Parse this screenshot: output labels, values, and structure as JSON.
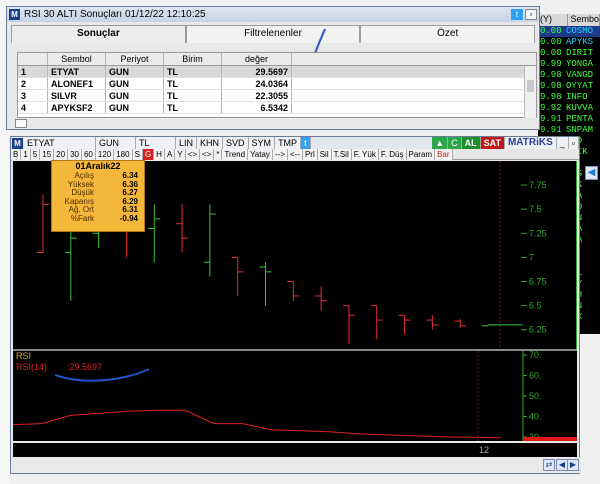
{
  "rsi_window": {
    "title": "RSI 30 ALTI Sonuçları 01/12/22 12:10:25",
    "tabs": [
      {
        "label": "Sonuçlar",
        "active": true
      },
      {
        "label": "Filtrelenenler",
        "active": false
      },
      {
        "label": "Özet",
        "active": false
      }
    ],
    "columns": [
      "",
      "Sembol",
      "Periyot",
      "Birim",
      "değer"
    ],
    "rows": [
      {
        "idx": "1",
        "symbol": "ETYAT",
        "period": "GUN",
        "unit": "TL",
        "value": "29.5697"
      },
      {
        "idx": "2",
        "symbol": "ALONEF1",
        "period": "GUN",
        "unit": "TL",
        "value": "24.0364"
      },
      {
        "idx": "3",
        "symbol": "SILVR",
        "period": "GUN",
        "unit": "TL",
        "value": "22.3055"
      },
      {
        "idx": "4",
        "symbol": "APYKSF2",
        "period": "GUN",
        "unit": "TL",
        "value": "6.5342"
      }
    ]
  },
  "bg_list": {
    "header": [
      "(Y)",
      "Sembo"
    ],
    "rows": [
      {
        "v": "0.00",
        "s": "COSMO",
        "c": true
      },
      {
        "v": "0.00",
        "s": "APYKS",
        "c": true
      },
      {
        "v": "0.00",
        "s": "DIRIT"
      },
      {
        "v": "9.99",
        "s": "YONGA"
      },
      {
        "v": "9.98",
        "s": "VANGD"
      },
      {
        "v": "9.98",
        "s": "OYYAT"
      },
      {
        "v": "9.98",
        "s": "INFO"
      },
      {
        "v": "9.92",
        "s": "KUVVA"
      },
      {
        "v": "9.91",
        "s": "PENTA"
      },
      {
        "v": "9.91",
        "s": "SNPAM"
      },
      {
        "v": "",
        "s": "TGD"
      },
      {
        "v": "",
        "s": "ASIK"
      },
      {
        "v": "",
        "s": "HO"
      },
      {
        "v": "",
        "s": "NAS"
      },
      {
        "v": "",
        "s": "EFK"
      },
      {
        "v": "",
        "s": "MDA"
      },
      {
        "v": "",
        "s": "KYO"
      },
      {
        "v": "",
        "s": "LSN"
      },
      {
        "v": "",
        "s": "ZMA"
      },
      {
        "v": "",
        "s": "LHA"
      },
      {
        "v": "",
        "s": "GE"
      },
      {
        "v": "",
        "s": "TO"
      },
      {
        "v": "",
        "s": "CTL"
      },
      {
        "v": "",
        "s": "RAY"
      },
      {
        "v": "",
        "s": "MNH"
      },
      {
        "v": "",
        "s": "SEN"
      },
      {
        "v": "",
        "s": "REX"
      },
      {
        "v": "",
        "s": "A"
      }
    ]
  },
  "chart_toolbar1": [
    "ETYAT",
    "GUN",
    "TL",
    "LIN",
    "KHN",
    "SVD",
    "SYM",
    "TMP"
  ],
  "chart_toolbar1_right": {
    "al": "AL",
    "sat": "SAT",
    "brand": "MATRiKS"
  },
  "chart_toolbar2": [
    "B",
    "1",
    "5",
    "15",
    "20",
    "30",
    "60",
    "120",
    "180",
    "S",
    "G",
    "H",
    "A",
    "Y",
    "<>",
    "<>",
    "*",
    "Trend",
    "Yatay",
    "-->",
    "<--",
    "Prl",
    "Sil",
    "T.Sil",
    "F. Yük",
    "F. Düş",
    "Param",
    "Bar"
  ],
  "info_box": {
    "title": "01Aralık22",
    "rows": [
      {
        "k": "Açılış",
        "v": "6.34"
      },
      {
        "k": "Yüksek",
        "v": "6.36"
      },
      {
        "k": "Düşük",
        "v": "6.27"
      },
      {
        "k": "Kapanış",
        "v": "6.29"
      },
      {
        "k": "Ağ. Ort",
        "v": "6.31"
      },
      {
        "k": "%Fark",
        "v": "-0.94"
      }
    ]
  },
  "rsi_pane": {
    "label": "RSI",
    "series_label": "RSI(14)",
    "value": ":29.5697"
  },
  "timebar_label": "12",
  "chart_data": [
    {
      "type": "candlestick",
      "yticks": [
        "7.75",
        "7.5",
        "7.25",
        "7",
        "6.75",
        "6.5",
        "6.25"
      ],
      "ylim": [
        6.05,
        8.0
      ],
      "candles": [
        {
          "o": 7.05,
          "h": 7.65,
          "l": 7.05,
          "c": 7.55,
          "up": false
        },
        {
          "o": 7.05,
          "h": 7.55,
          "l": 6.55,
          "c": 7.2,
          "up": true
        },
        {
          "o": 7.25,
          "h": 7.7,
          "l": 7.1,
          "c": 7.55,
          "up": true
        },
        {
          "o": 7.3,
          "h": 7.6,
          "l": 7.0,
          "c": 7.4,
          "up": false
        },
        {
          "o": 7.3,
          "h": 7.55,
          "l": 6.95,
          "c": 7.4,
          "up": true
        },
        {
          "o": 7.35,
          "h": 7.55,
          "l": 7.05,
          "c": 7.2,
          "up": false
        },
        {
          "o": 6.95,
          "h": 7.55,
          "l": 6.8,
          "c": 7.45,
          "up": true
        },
        {
          "o": 7.0,
          "h": 7.0,
          "l": 6.6,
          "c": 6.85,
          "up": false
        },
        {
          "o": 6.9,
          "h": 6.95,
          "l": 6.5,
          "c": 6.85,
          "up": true
        },
        {
          "o": 6.75,
          "h": 6.75,
          "l": 6.55,
          "c": 6.6,
          "up": false
        },
        {
          "o": 6.6,
          "h": 6.7,
          "l": 6.45,
          "c": 6.55,
          "up": false
        },
        {
          "o": 6.5,
          "h": 6.5,
          "l": 6.1,
          "c": 6.4,
          "up": false
        },
        {
          "o": 6.5,
          "h": 6.5,
          "l": 6.15,
          "c": 6.35,
          "up": false
        },
        {
          "o": 6.4,
          "h": 6.4,
          "l": 6.2,
          "c": 6.35,
          "up": false
        },
        {
          "o": 6.35,
          "h": 6.4,
          "l": 6.25,
          "c": 6.3,
          "up": false
        },
        {
          "o": 6.34,
          "h": 6.36,
          "l": 6.27,
          "c": 6.29,
          "up": false
        },
        {
          "o": 6.29,
          "h": 6.3,
          "l": 6.29,
          "c": 6.3,
          "up": true
        }
      ]
    },
    {
      "type": "line",
      "name": "RSI(14)",
      "yticks": [
        "70.",
        "60.",
        "50.",
        "40.",
        "30."
      ],
      "ylim": [
        28,
        72
      ],
      "values": [
        36,
        36.5,
        40.5,
        41.5,
        42.5,
        43,
        43,
        36.5,
        36.5,
        33.5,
        33,
        32.5,
        31.5,
        31,
        30.5,
        30,
        29.8,
        29.5
      ]
    }
  ]
}
